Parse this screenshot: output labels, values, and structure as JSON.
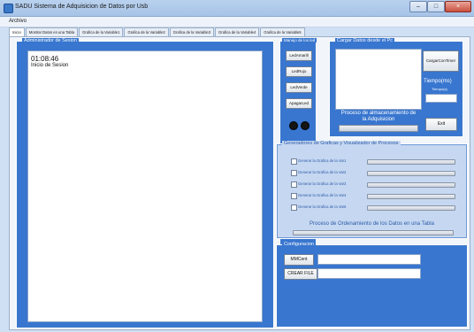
{
  "window": {
    "title": "SADU Sistema de Adquisicion de Datos por Usb",
    "minimize": "–",
    "maximize": "□",
    "close": "×"
  },
  "menu": {
    "archivo": "Archivo"
  },
  "tabs": [
    {
      "label": "Inicio"
    },
    {
      "label": "Mostrar Datos en una Tabla"
    },
    {
      "label": "Grafica de la Variable1"
    },
    {
      "label": "Grafica de la Variable2"
    },
    {
      "label": "Grafica de la Variable3"
    },
    {
      "label": "Grafica de la Variable4"
    },
    {
      "label": "Grafica de la Variable5"
    }
  ],
  "session": {
    "title": "Administrador de Sesion",
    "time": "01:08:46",
    "status": "Inicio de Sesion"
  },
  "leds": {
    "title": "Manejo de los led",
    "buttons": [
      "LedAmarill",
      "LedRojo",
      "LedVerde",
      "ApagarLed"
    ]
  },
  "pc": {
    "title": "Cargar Datos desde el Pc",
    "cargar_timer": "CargarConTimer",
    "tiempo_label": "Tiempo(ms)",
    "tiempo_sub": "Tiempo(s)",
    "proceso_label": "Proceso de almacenamiento de la Adquisicion",
    "exit": "Exit"
  },
  "graphs": {
    "title": "Generadores de Graficas y Visualizador de Procesos",
    "rows": [
      {
        "label": "Generar la Grafica de la Var1"
      },
      {
        "label": "Generar la Grafica de la Var2"
      },
      {
        "label": "Generar la Grafica de la Var3"
      },
      {
        "label": "Generar la Grafica de la Var4"
      },
      {
        "label": "Generar la Grafica de la Var5"
      }
    ],
    "footer": "Proceso de Ordenamiento de los Datos en una Tabla"
  },
  "config": {
    "title": "Configuracion",
    "mmcent": "MMCent",
    "crear_file": "CREAR FILE"
  }
}
